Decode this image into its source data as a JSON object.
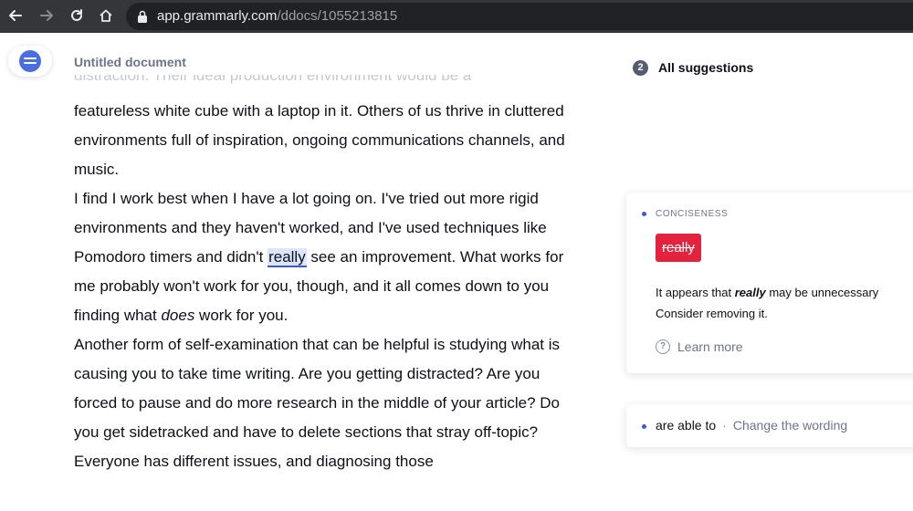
{
  "browser": {
    "url_host": "app.grammarly.com",
    "url_path": "/ddocs/1055213815"
  },
  "document": {
    "title": "Untitled document",
    "faded_line": "distraction. Their ideal production environment would be a",
    "paragraphs": [
      {
        "before": "featureless white cube with a laptop in it. Others of us thrive in cluttered environments full of inspiration, ongoing communications channels, and music."
      },
      {
        "before": "I find I work best when I have a lot going on. I've tried out more rigid environments and they haven't worked, and I've used techniques like Pomodoro timers and didn't ",
        "flagged": "really",
        "after": " see an improvement. What works for me probably won't work for you, though, and it all comes down to you finding what ",
        "emphasis": "does",
        "after2": " work for you."
      },
      {
        "before": "Another form of self-examination that can be helpful is studying what is causing you to take time writing. Are you getting distracted? Are you forced to pause and do more research in the middle of your article? Do you get sidetracked and have to delete sections that stray off-topic? Everyone has different issues, and diagnosing those"
      }
    ]
  },
  "suggestions": {
    "count": "2",
    "header": "All suggestions",
    "main_card": {
      "category": "CONCISENESS",
      "removed_word": "really",
      "explain_before": "It appears that ",
      "explain_word": "really",
      "explain_after": " may be unnecessary",
      "explain_line2": "Consider removing it.",
      "learn_more": "Learn more"
    },
    "second_card": {
      "phrase": "are able to",
      "separator": "·",
      "action": "Change the wording"
    }
  },
  "colors": {
    "accent": "#3d5ad8",
    "error_chip": "#e4223e",
    "highlight": "#dce5fb"
  }
}
